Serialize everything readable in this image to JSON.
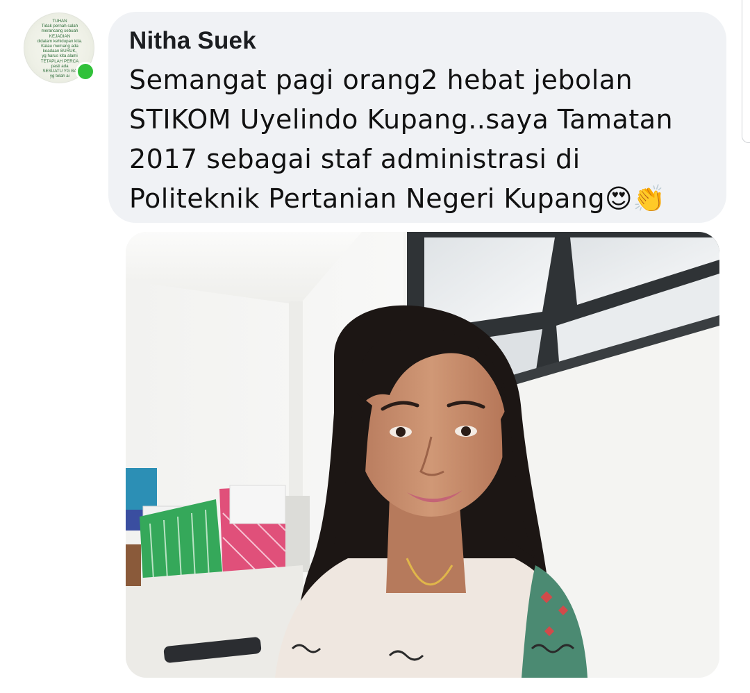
{
  "comment": {
    "author": "Nitha Suek",
    "text": "Semangat pagi orang2 hebat jebolan STIKOM Uyelindo Kupang..saya Tamatan 2017 sebagai staf administrasi di Politeknik Pertanian Negeri Kupang😍👏",
    "avatar_text": "TUHAN\nTidak pernah salah\nmerancang sebuah\nKEJADIAN\ndidalam kehidupan kita.\nKalau memang ada\nkeadaan BURUK,\nyg harus kita alami\nTETAPLAH PERCA\npasti ada\nSESUATU YG BA\nyg telah ai",
    "online": true
  },
  "colors": {
    "bubble": "#f0f2f5",
    "online": "#31c13a",
    "author": "#1c1e21"
  }
}
